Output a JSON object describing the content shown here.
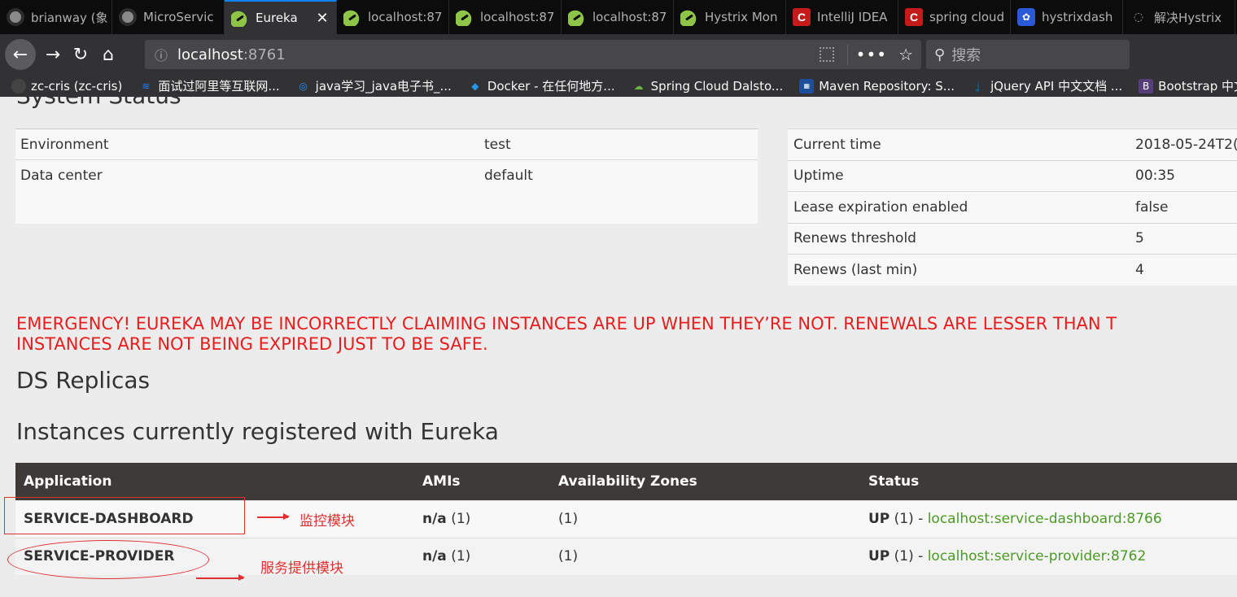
{
  "browser": {
    "tabs": [
      {
        "label": "brianway (象",
        "icon": "github-icon"
      },
      {
        "label": "MicroServic",
        "icon": "github-icon"
      },
      {
        "label": "Eureka",
        "icon": "spring-leaf-icon",
        "active": true
      },
      {
        "label": "localhost:87",
        "icon": "spring-leaf-icon"
      },
      {
        "label": "localhost:87",
        "icon": "spring-leaf-icon"
      },
      {
        "label": "localhost:87",
        "icon": "spring-leaf-icon"
      },
      {
        "label": "Hystrix Mon",
        "icon": "spring-leaf-icon"
      },
      {
        "label": "IntelliJ IDEA",
        "icon": "csdn-icon"
      },
      {
        "label": "spring cloud",
        "icon": "csdn-icon"
      },
      {
        "label": "hystrixdash",
        "icon": "baidu-icon"
      },
      {
        "label": "解决Hystrix",
        "icon": "page-icon"
      }
    ],
    "close_glyph": "✕",
    "url_host": "localhost",
    "url_port": ":8761",
    "search_placeholder": "搜索",
    "bookmarks": [
      {
        "label": "zc-cris (zc-cris)",
        "icon": "github-icon"
      },
      {
        "label": "面试过阿里等互联网...",
        "icon": "juejin-icon"
      },
      {
        "label": "java学习_java电子书_...",
        "icon": "wifi-icon"
      },
      {
        "label": "Docker - 在任何地方...",
        "icon": "docker-icon"
      },
      {
        "label": "Spring Cloud Dalsto...",
        "icon": "spring-cloud-icon"
      },
      {
        "label": "Maven Repository: S...",
        "icon": "maven-icon"
      },
      {
        "label": "jQuery API 中文文档 ...",
        "icon": "jquery-icon"
      },
      {
        "label": "Bootstrap 中文文档",
        "icon": "bootstrap-icon"
      }
    ]
  },
  "page": {
    "system_status_title": "System Status",
    "env_rows": [
      {
        "key": "Environment",
        "value": "test"
      },
      {
        "key": "Data center",
        "value": "default"
      }
    ],
    "status_rows": [
      {
        "key": "Current time",
        "value": "2018-05-24T2("
      },
      {
        "key": "Uptime",
        "value": "00:35"
      },
      {
        "key": "Lease expiration enabled",
        "value": "false"
      },
      {
        "key": "Renews threshold",
        "value": "5"
      },
      {
        "key": "Renews (last min)",
        "value": "4"
      }
    ],
    "emergency_line1": "EMERGENCY! EUREKA MAY BE INCORRECTLY CLAIMING INSTANCES ARE UP WHEN THEY’RE NOT. RENEWALS ARE LESSER THAN T",
    "emergency_line2": "INSTANCES ARE NOT BEING EXPIRED JUST TO BE SAFE.",
    "ds_replicas_title": "DS Replicas",
    "instances_title": "Instances currently registered with Eureka",
    "instance_headers": [
      "Application",
      "AMIs",
      "Availability Zones",
      "Status"
    ],
    "instances": [
      {
        "app": "SERVICE-DASHBOARD",
        "ami_bold": "n/a",
        "ami_count": " (1)",
        "zones": "(1)",
        "status_bold": "UP",
        "status_count": " (1) - ",
        "link": "localhost:service-dashboard:8766"
      },
      {
        "app": "SERVICE-PROVIDER",
        "ami_bold": "n/a",
        "ami_count": " (1)",
        "zones": "(1)",
        "status_bold": "UP",
        "status_count": " (1) - ",
        "link": "localhost:service-provider:8762"
      }
    ],
    "annotations": {
      "dashboard_note": "监控模块",
      "provider_note": "服务提供模块"
    }
  },
  "colors": {
    "accent": "#0a84ff",
    "emergency_red": "#e81d1d",
    "link_green": "#4c9a26",
    "table_header": "#3e3a37",
    "annotation_red": "#e0302f"
  }
}
